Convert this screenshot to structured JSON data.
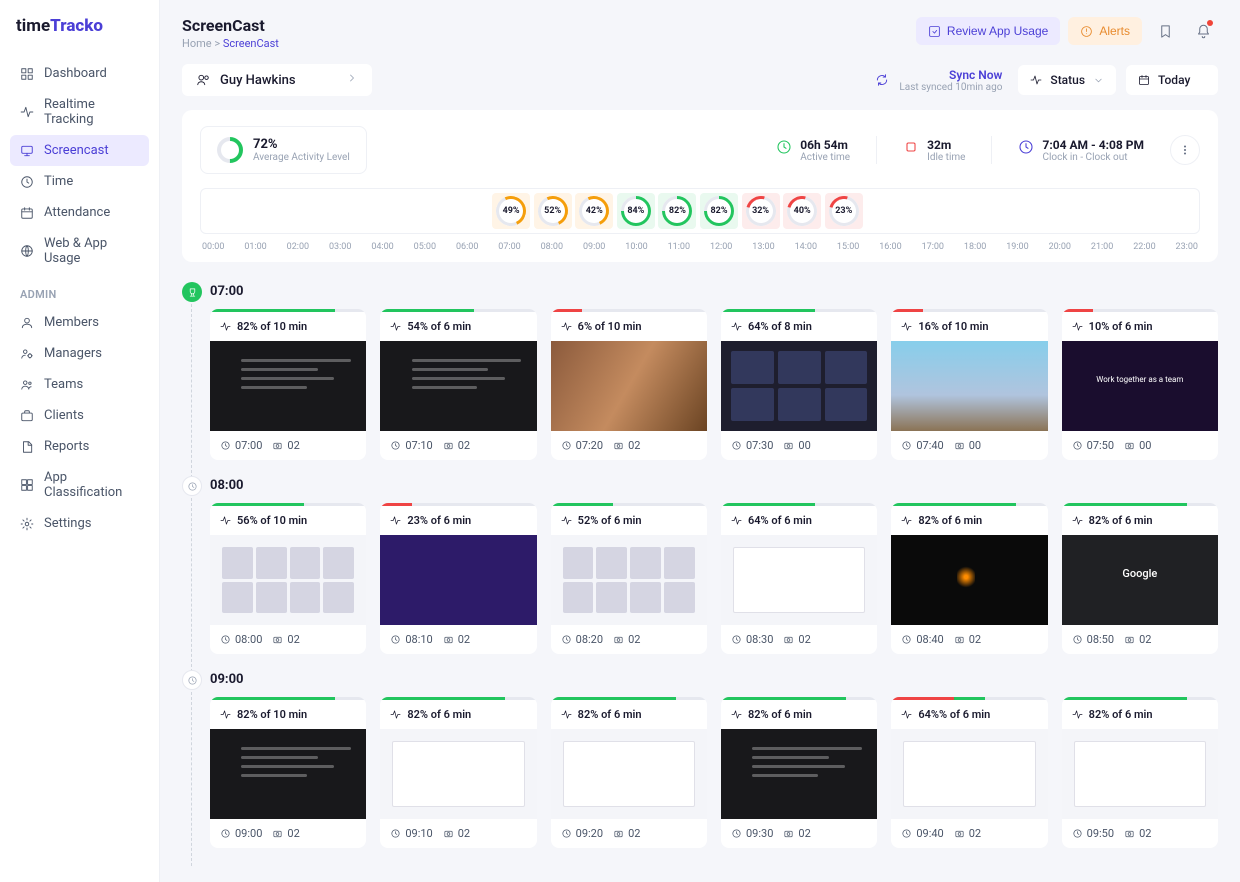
{
  "logo": {
    "part1": "time",
    "part2": "Tracko"
  },
  "nav": {
    "main": [
      {
        "label": "Dashboard",
        "icon": "dashboard"
      },
      {
        "label": "Realtime Tracking",
        "icon": "activity"
      },
      {
        "label": "Screencast",
        "icon": "monitor",
        "active": true
      },
      {
        "label": "Time",
        "icon": "clock"
      },
      {
        "label": "Attendance",
        "icon": "calendar"
      },
      {
        "label": "Web & App Usage",
        "icon": "globe"
      }
    ],
    "admin_label": "ADMIN",
    "admin": [
      {
        "label": "Members",
        "icon": "user"
      },
      {
        "label": "Managers",
        "icon": "users-gear"
      },
      {
        "label": "Teams",
        "icon": "users"
      },
      {
        "label": "Clients",
        "icon": "briefcase"
      },
      {
        "label": "Reports",
        "icon": "file"
      },
      {
        "label": "App Classification",
        "icon": "grid"
      },
      {
        "label": "Settings",
        "icon": "gear"
      }
    ]
  },
  "header": {
    "title": "ScreenCast",
    "breadcrumb_home": "Home",
    "breadcrumb_sep": " > ",
    "breadcrumb_current": "ScreenCast",
    "review_btn": "Review App Usage",
    "alerts_btn": "Alerts"
  },
  "toolbar": {
    "user": "Guy Hawkins",
    "sync_title": "Sync Now",
    "sync_sub": "Last synced 10min ago",
    "status_label": "Status",
    "today_label": "Today"
  },
  "stats": {
    "avg_pct": "72%",
    "avg_label": "Average Activity Level",
    "active_val": "06h 54m",
    "active_label": "Active time",
    "idle_val": "32m",
    "idle_label": "Idle time",
    "clock_val": "7:04 AM - 4:08 PM",
    "clock_label": "Clock in - Clock out",
    "timeline": [
      {
        "pct": "49%",
        "color": "orange",
        "pos": 7
      },
      {
        "pct": "52%",
        "color": "orange",
        "pos": 8
      },
      {
        "pct": "42%",
        "color": "orange",
        "pos": 9
      },
      {
        "pct": "84%",
        "color": "green",
        "pos": 10
      },
      {
        "pct": "82%",
        "color": "green",
        "pos": 11
      },
      {
        "pct": "82%",
        "color": "green",
        "pos": 12
      },
      {
        "pct": "32%",
        "color": "red",
        "pos": 13
      },
      {
        "pct": "40%",
        "color": "red",
        "pos": 14
      },
      {
        "pct": "23%",
        "color": "red",
        "pos": 15
      }
    ],
    "hours": [
      "00:00",
      "01:00",
      "02:00",
      "03:00",
      "04:00",
      "05:00",
      "06:00",
      "07:00",
      "08:00",
      "09:00",
      "10:00",
      "11:00",
      "12:00",
      "13:00",
      "14:00",
      "15:00",
      "16:00",
      "17:00",
      "18:00",
      "19:00",
      "20:00",
      "21:00",
      "22:00",
      "23:00"
    ]
  },
  "sections": [
    {
      "hour": "07:00",
      "first": true,
      "cards": [
        {
          "pct": "82% of 10 min",
          "time": "07:00",
          "shots": "02",
          "bar": [
            "g",
            "g",
            "g",
            "g",
            "e"
          ],
          "thumb": "dark-lines"
        },
        {
          "pct": "54% of 6 min",
          "time": "07:10",
          "shots": "02",
          "bar": [
            "g",
            "g",
            "g",
            "e",
            "e"
          ],
          "thumb": "dark-lines"
        },
        {
          "pct": "6% of 10 min",
          "time": "07:20",
          "shots": "02",
          "bar": [
            "r",
            "e",
            "e",
            "e",
            "e"
          ],
          "thumb": "video"
        },
        {
          "pct": "64% of 8 min",
          "time": "07:30",
          "shots": "00",
          "bar": [
            "g",
            "g",
            "g",
            "e",
            "e"
          ],
          "thumb": "dash"
        },
        {
          "pct": "16% of 10 min",
          "time": "07:40",
          "shots": "00",
          "bar": [
            "r",
            "e",
            "e",
            "e",
            "e"
          ],
          "thumb": "anime"
        },
        {
          "pct": "10% of 6 min",
          "time": "07:50",
          "shots": "00",
          "bar": [
            "r",
            "e",
            "e",
            "e",
            "e"
          ],
          "thumb": "team"
        }
      ]
    },
    {
      "hour": "08:00",
      "first": false,
      "cards": [
        {
          "pct": "56% of 10 min",
          "time": "08:00",
          "shots": "02",
          "bar": [
            "g",
            "g",
            "g",
            "e",
            "e"
          ],
          "thumb": "light-grid"
        },
        {
          "pct": "23% of 6 min",
          "time": "08:10",
          "shots": "02",
          "bar": [
            "r",
            "e",
            "e",
            "e",
            "e"
          ],
          "thumb": "purple"
        },
        {
          "pct": "52% of 6 min",
          "time": "08:20",
          "shots": "02",
          "bar": [
            "g",
            "g",
            "e",
            "e",
            "e"
          ],
          "thumb": "light-grid"
        },
        {
          "pct": "64% of 6 min",
          "time": "08:30",
          "shots": "02",
          "bar": [
            "g",
            "g",
            "g",
            "e",
            "e"
          ],
          "thumb": "light-card"
        },
        {
          "pct": "82% of 6 min",
          "time": "08:40",
          "shots": "02",
          "bar": [
            "g",
            "g",
            "g",
            "g",
            "e"
          ],
          "thumb": "black-center"
        },
        {
          "pct": "82% of 6 min",
          "time": "08:50",
          "shots": "02",
          "bar": [
            "g",
            "g",
            "g",
            "g",
            "e"
          ],
          "thumb": "google"
        }
      ]
    },
    {
      "hour": "09:00",
      "first": false,
      "cards": [
        {
          "pct": "82% of 10 min",
          "time": "09:00",
          "shots": "02",
          "bar": [
            "g",
            "g",
            "g",
            "g",
            "e"
          ],
          "thumb": "dark-lines"
        },
        {
          "pct": "82% of 6 min",
          "time": "09:10",
          "shots": "02",
          "bar": [
            "g",
            "g",
            "g",
            "g",
            "e"
          ],
          "thumb": "light-card"
        },
        {
          "pct": "82% of 6 min",
          "time": "09:20",
          "shots": "02",
          "bar": [
            "g",
            "g",
            "g",
            "g",
            "e"
          ],
          "thumb": "light-card"
        },
        {
          "pct": "82% of 6 min",
          "time": "09:30",
          "shots": "02",
          "bar": [
            "g",
            "g",
            "g",
            "g",
            "e"
          ],
          "thumb": "dark-lines"
        },
        {
          "pct": "64%% of 6 min",
          "time": "09:40",
          "shots": "02",
          "bar": [
            "r",
            "r",
            "g",
            "e",
            "e"
          ],
          "thumb": "light-card"
        },
        {
          "pct": "82% of 6 min",
          "time": "09:50",
          "shots": "02",
          "bar": [
            "g",
            "g",
            "g",
            "g",
            "e"
          ],
          "thumb": "light-card"
        }
      ]
    }
  ]
}
